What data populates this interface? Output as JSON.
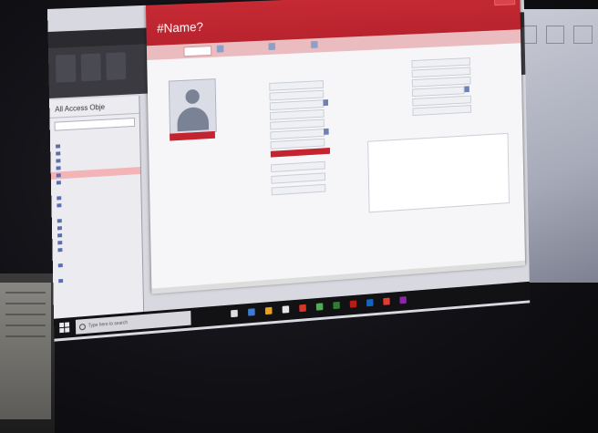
{
  "form": {
    "title": "#Name?"
  },
  "navigation": {
    "title": "All Access Obje"
  },
  "taskbar": {
    "search_placeholder": "Type here to search"
  },
  "colors": {
    "accent_red": "#c62a34",
    "toolbar_pink": "#ebbcbf",
    "taskbar": "#121214"
  },
  "icons": [
    "windows-start-icon",
    "search-icon",
    "person-placeholder-icon"
  ]
}
